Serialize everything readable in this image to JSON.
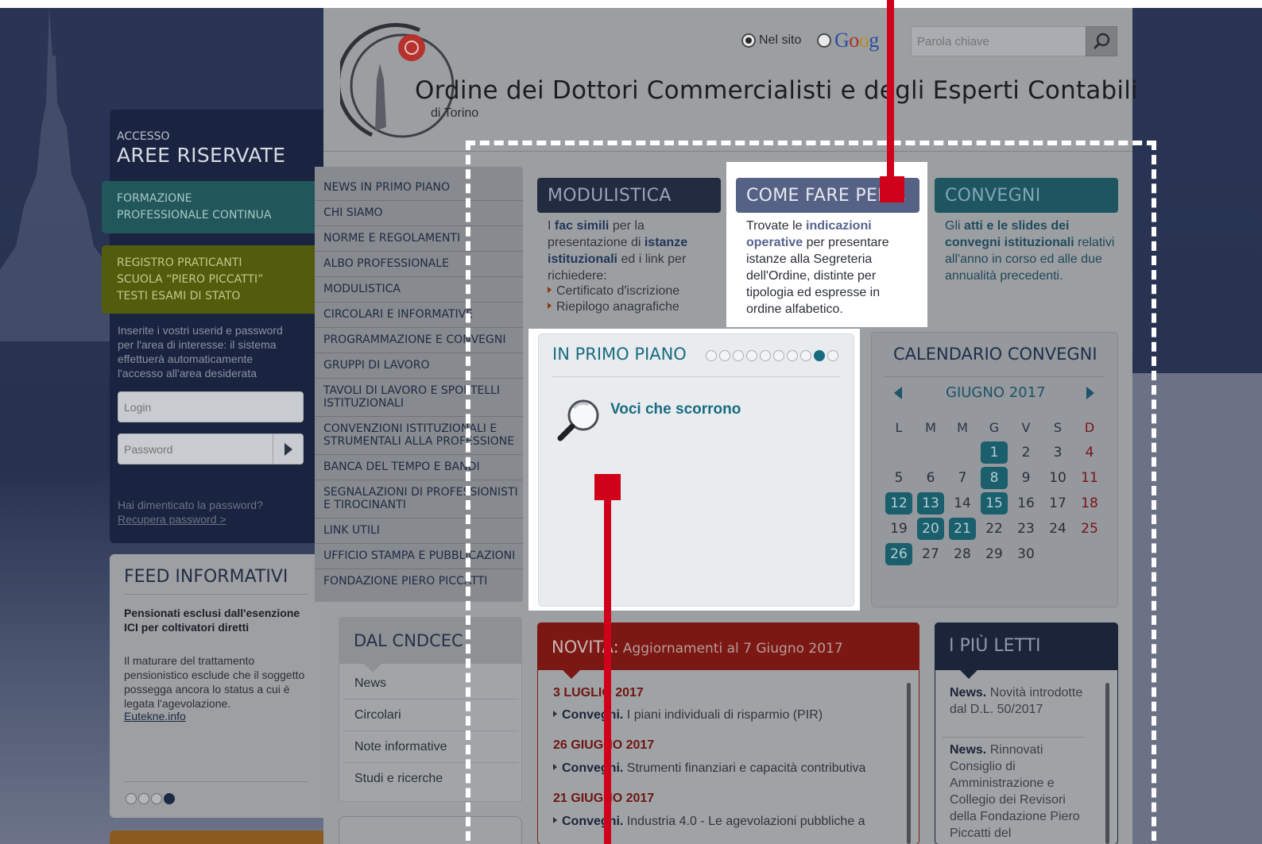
{
  "header": {
    "search_scope": [
      "Nel sito",
      "Google"
    ],
    "search_scope_selected": "Nel sito",
    "search_placeholder": "Parola chiave",
    "title": "Ordine dei Dottori Commercialisti e degli Esperti Contabili",
    "subtitle": "di Torino"
  },
  "login": {
    "access_small": "ACCESSO",
    "access_big": "AREE RISERVATE",
    "fpc": [
      "FORMAZIONE",
      "PROFESSIONALE CONTINUA"
    ],
    "registro": [
      "REGISTRO PRATICANTI",
      "SCUOLA “PIERO PICCATTI”",
      "TESTI ESAMI DI STATO"
    ],
    "help": "Inserite i vostri userid e password per l'area di interesse: il sistema effettuerà automaticamente l'accesso all'area desiderata",
    "login_placeholder": "Login",
    "password_placeholder": "Password",
    "forgot": "Hai dimenticato la password?",
    "recover": "Recupera password >"
  },
  "feed": {
    "title": "FEED INFORMATIVI",
    "headline": "Pensionati esclusi dall'esenzione ICI per coltivatori diretti",
    "body": "Il maturare del trattamento pensionistico esclude che il soggetto possegga ancora lo status a cui è legata l'agevolazione.",
    "source": "Eutekne.info",
    "dots_total": 4,
    "dots_active": 4
  },
  "nav": {
    "items": [
      [
        "NEWS  IN PRIMO PIANO"
      ],
      [
        "CHI SIAMO"
      ],
      [
        "NORME E REGOLAMENTI"
      ],
      [
        "ALBO PROFESSIONALE"
      ],
      [
        "MODULISTICA"
      ],
      [
        "CIRCOLARI E INFORMATIVE"
      ],
      [
        "PROGRAMMAZIONE E CONVEGNI"
      ],
      [
        "GRUPPI DI LAVORO"
      ],
      [
        "TAVOLI DI LAVORO E SPORTELLI",
        "ISTITUZIONALI"
      ],
      [
        "CONVENZIONI ISTITUZIONALI E",
        "STRUMENTALI ALLA PROFESSIONE"
      ],
      [
        "BANCA DEL TEMPO E BANDI"
      ],
      [
        "SEGNALAZIONI DI PROFESSIONISTI",
        "E TIROCINANTI"
      ],
      [
        "LINK UTILI"
      ],
      [
        "UFFICIO STAMPA E PUBBLICAZIONI"
      ],
      [
        "FONDAZIONE PIERO PICCATTI"
      ]
    ]
  },
  "cndcec": {
    "title": "DAL CNDCEC",
    "items": [
      "News",
      "Circolari",
      "Note informative",
      "Studi e ricerche"
    ]
  },
  "modulistica": {
    "title": "MODULISTICA",
    "text_parts": [
      [
        "I ",
        false
      ],
      [
        "fac simili",
        true
      ],
      [
        " per la presentazione di ",
        false
      ],
      [
        "istanze istituzionali",
        true
      ],
      [
        " ed i link per richiedere:",
        false
      ]
    ],
    "bullets": [
      "Certificato d'iscrizione",
      "Riepilogo anagrafiche"
    ]
  },
  "come_fare": {
    "title": "COME FARE PER...",
    "text_parts": [
      [
        "Trovate le ",
        false
      ],
      [
        "indicazioni operative",
        true
      ],
      [
        " per presentare istanze alla Segreteria dell'Ordine, distinte per tipologia ed espresse in ordine alfabetico.",
        false
      ]
    ]
  },
  "convegni": {
    "title": "CONVEGNI",
    "text_parts": [
      [
        "Gli ",
        false
      ],
      [
        "atti e le slides dei convegni istituzionali",
        true
      ],
      [
        " relativi all'anno in corso ed alle due annualità precedenti.",
        false
      ]
    ]
  },
  "in_primo_piano": {
    "title": "IN PRIMO PIANO",
    "slides_total": 10,
    "slide_active": 9,
    "item": "Voci che scorrono"
  },
  "calendar": {
    "title": "CALENDARIO CONVEGNI",
    "month": "GIUGNO 2017",
    "weekdays": [
      "L",
      "M",
      "M",
      "G",
      "V",
      "S",
      "D"
    ],
    "first_weekday_index": 3,
    "days": 30,
    "event_days": [
      1,
      8,
      12,
      13,
      15,
      20,
      21,
      26
    ]
  },
  "novita": {
    "label": "NOVITÀ:",
    "subtitle": "Aggiornamenti al 7 Giugno 2017",
    "entries": [
      {
        "date": "3 LUGLIO 2017",
        "type": "Convegni.",
        "text": "I piani individuali di risparmio (PIR)"
      },
      {
        "date": "26 GIUGNO 2017",
        "type": "Convegni.",
        "text": "Strumenti finanziari e capacità contributiva"
      },
      {
        "date": "21 GIUGNO 2017",
        "type": "Convegni.",
        "text": "Industria 4.0 - Le agevolazioni pubbliche a"
      }
    ]
  },
  "piu_letti": {
    "title": "I PIÙ LETTI",
    "items": [
      {
        "type": "News.",
        "text": "Novità introdotte dal D.L. 50/2017"
      },
      {
        "type": "News.",
        "text": "Rinnovati Consiglio di Amministrazione e Collegio dei Revisori della Fondazione Piero Piccatti del"
      }
    ]
  },
  "colors": {
    "accent_red": "#d0021b",
    "teal": "#1a6c82",
    "navy": "#1b2438",
    "dim_overlay": "#1f2a44"
  }
}
